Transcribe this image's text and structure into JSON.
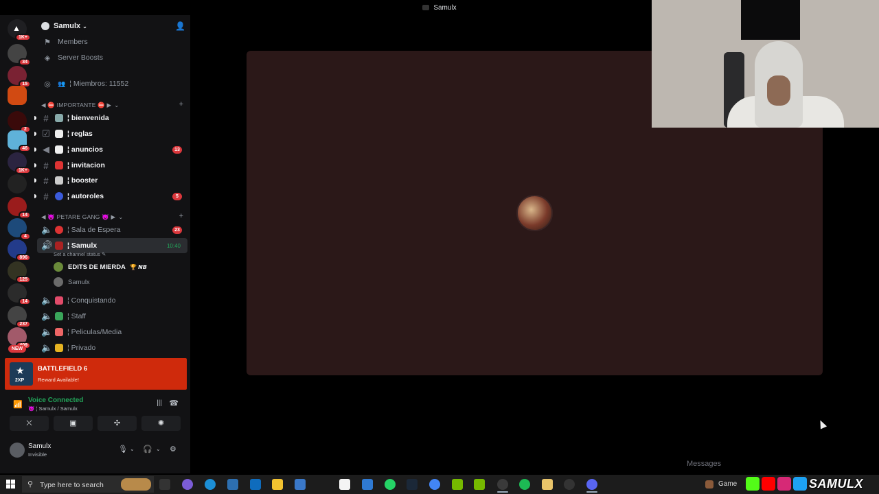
{
  "window": {
    "title": "Samulx"
  },
  "rail": {
    "badges": [
      "1K+",
      "34",
      "15",
      "2",
      "46",
      "1K+",
      "14",
      "4",
      "896",
      "125",
      "14",
      "237",
      "409"
    ],
    "new_label": "NEW"
  },
  "server": {
    "name": "Samulx",
    "menu": [
      {
        "label": "Members",
        "icon": "members-icon"
      },
      {
        "label": "Server Boosts",
        "icon": "boost-icon"
      }
    ],
    "member_count": "¦ Miembros: 11552"
  },
  "categories": [
    {
      "label": "◀ ⛔ IMPORTANTE ⛔ ▶"
    },
    {
      "label": "◀ 😈 PETARE GANG 😈 ▶"
    }
  ],
  "text_channels": [
    {
      "name": "¦ bienvenida",
      "count": ""
    },
    {
      "name": "¦ reglas",
      "count": ""
    },
    {
      "name": "¦ anuncios",
      "count": "13"
    },
    {
      "name": "¦ invitacion",
      "count": ""
    },
    {
      "name": "¦ booster",
      "count": ""
    },
    {
      "name": "¦ autoroles",
      "count": "5"
    }
  ],
  "voice_channels": [
    {
      "name": "¦ Sala de Espera",
      "count": "23"
    },
    {
      "name": "¦ Samulx",
      "time": "10:40"
    },
    {
      "name": "¦ Conquistando"
    },
    {
      "name": "¦ Staff"
    },
    {
      "name": "¦ Peliculas/Media"
    },
    {
      "name": "¦ Privado"
    }
  ],
  "channel_status": "Set a channel status ✎",
  "voice_users": [
    {
      "name": "EDITS DE MIERDA",
      "tag": "🏆 𝙉𝘽"
    },
    {
      "name": "Samulx",
      "tag": ""
    }
  ],
  "promo": {
    "title": "BATTLEFIELD 6",
    "subtitle": "Reward Available!",
    "badge": "2XP"
  },
  "voice_status": {
    "title": "Voice Connected",
    "subtitle": "😈 ¦ Samulx / Samulx"
  },
  "user": {
    "name": "Samulx",
    "status": "Invisible"
  },
  "taskbar": {
    "search_placeholder": "Type here to search",
    "game_label": "Game",
    "brand": "SAMULX"
  },
  "peek_text": "Messages",
  "colors": {
    "accent_green": "#23a55a",
    "badge_red": "#da373c",
    "promo_red": "#cf2a0c",
    "stage_bg": "#2b1818"
  }
}
